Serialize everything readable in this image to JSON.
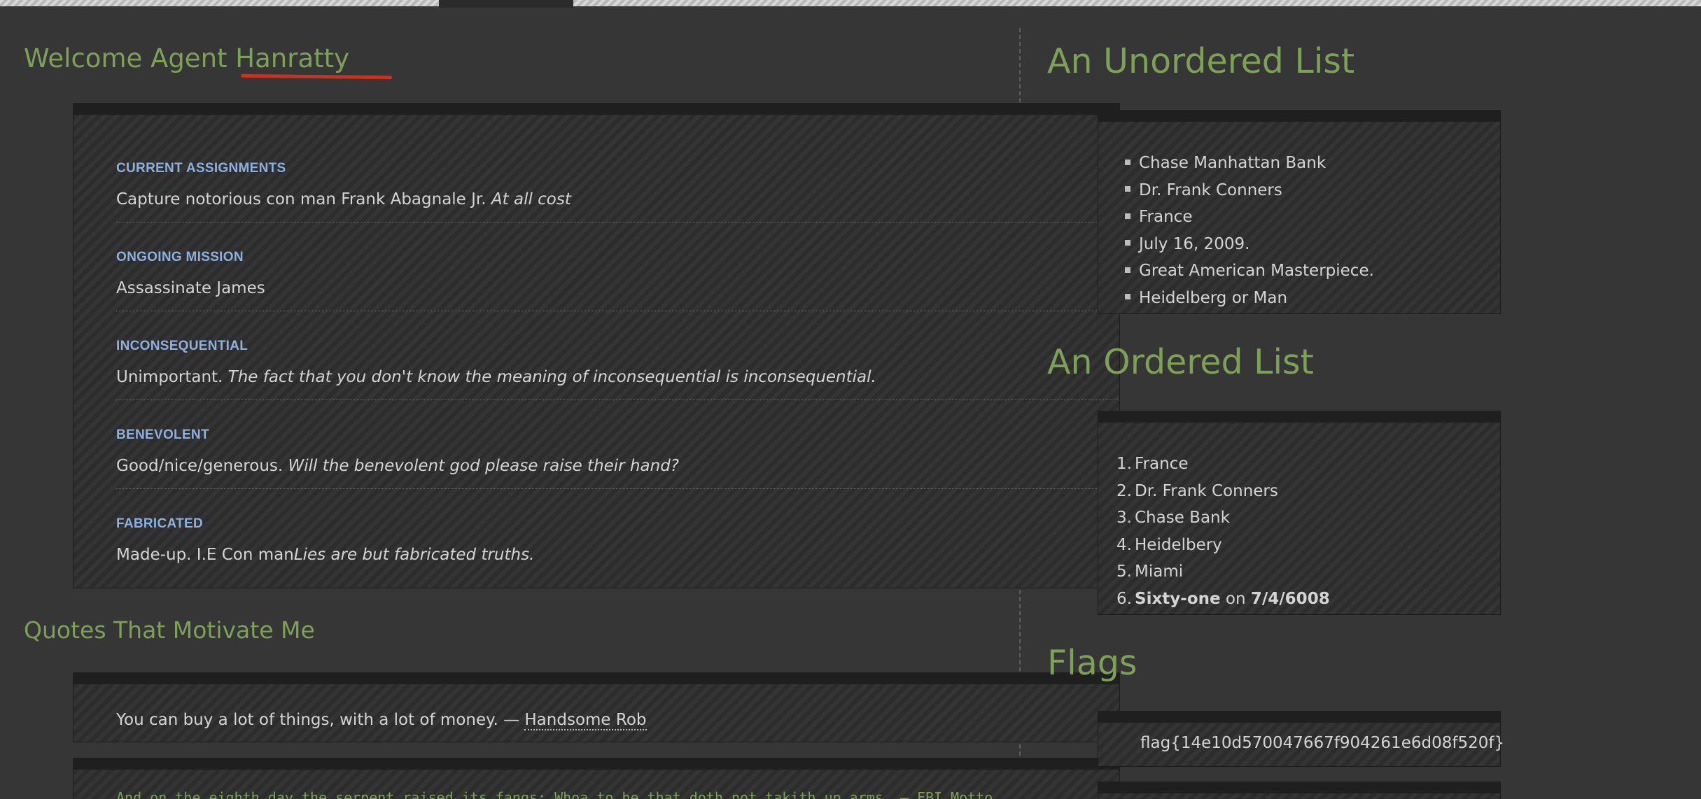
{
  "welcome": {
    "prefix": "Welcome Agent ",
    "name": "Hanratty"
  },
  "definitions": [
    {
      "term": "CURRENT ASSIGNMENTS",
      "text": "Capture notorious con man Frank Abagnale Jr. ",
      "emphasis": "At all cost"
    },
    {
      "term": "ONGOING MISSION",
      "text": "Assassinate James",
      "emphasis": ""
    },
    {
      "term": "INCONSEQUENTIAL",
      "text": "Unimportant. ",
      "emphasis": "The fact that you don't know the meaning of inconsequential is inconsequential."
    },
    {
      "term": "BENEVOLENT",
      "text": "Good/nice/generous. ",
      "emphasis": "Will the benevolent god please raise their hand?"
    },
    {
      "term": "FABRICATED",
      "text": "Made-up. I.E Con man",
      "emphasis": "Lies are but fabricated truths."
    }
  ],
  "quotes_section": {
    "title": "Quotes That Motivate Me",
    "quote1": {
      "text": "You can buy a lot of things, with a lot of money. — ",
      "author": "Handsome Rob"
    },
    "quote2": {
      "text": "And on the eighth day the serpent raised its fangs; Whoa to he that doth not takith up arms. — FBI Motto"
    }
  },
  "unordered_list": {
    "title": "An Unordered List",
    "items": [
      "Chase Manhattan Bank",
      "Dr. Frank Conners",
      "France",
      "July 16, 2009.",
      "Great American Masterpiece.",
      "Heidelberg or Man"
    ]
  },
  "ordered_list": {
    "title": "An Ordered List",
    "items": [
      "France",
      "Dr. Frank Conners",
      "Chase Bank",
      "Heidelbery",
      "Miami"
    ],
    "last_item": {
      "bold1": "Sixty-one",
      "middle": " on ",
      "bold2": "7/4/6008"
    }
  },
  "flags": {
    "title": "Flags",
    "value": "flag{14e10d570047667f904261e6d08f520f}"
  },
  "icons": {
    "bullet": "square-bullet-icon"
  }
}
